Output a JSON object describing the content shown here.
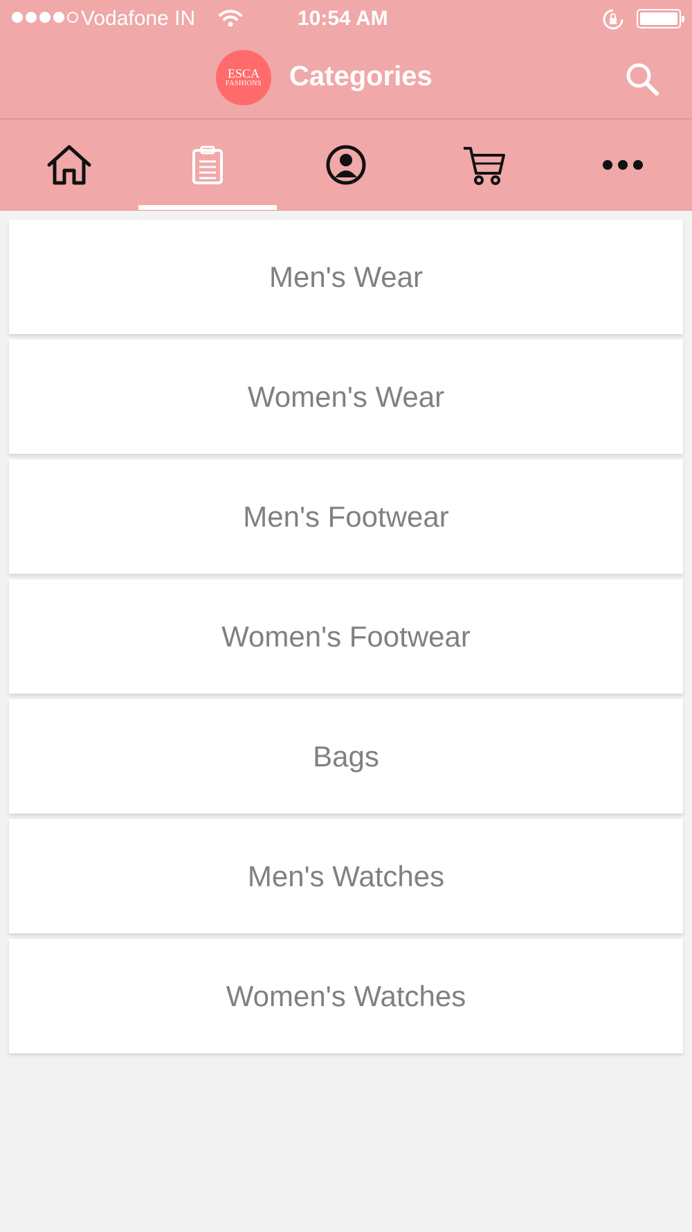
{
  "status_bar": {
    "carrier": "Vodafone IN",
    "time": "10:54 AM",
    "signal_strength": 4,
    "battery": "full"
  },
  "header": {
    "logo_line1": "ESCA",
    "logo_line2": "FASHIONS",
    "title": "Categories",
    "search_icon": "search-icon"
  },
  "tabs": [
    {
      "icon": "home-icon",
      "active": false
    },
    {
      "icon": "clipboard-icon",
      "active": true
    },
    {
      "icon": "profile-icon",
      "active": false
    },
    {
      "icon": "cart-icon",
      "active": false
    },
    {
      "icon": "more-icon",
      "active": false
    }
  ],
  "categories": [
    {
      "label": "Men's Wear"
    },
    {
      "label": "Women's Wear"
    },
    {
      "label": "Men's Footwear"
    },
    {
      "label": "Women's Footwear"
    },
    {
      "label": "Bags"
    },
    {
      "label": "Men's Watches"
    },
    {
      "label": "Women's Watches"
    }
  ],
  "colors": {
    "header_bg": "#f0a8a8",
    "logo_bg": "#ff6b6b",
    "item_text": "#808080",
    "page_bg": "#f2f2f2"
  }
}
